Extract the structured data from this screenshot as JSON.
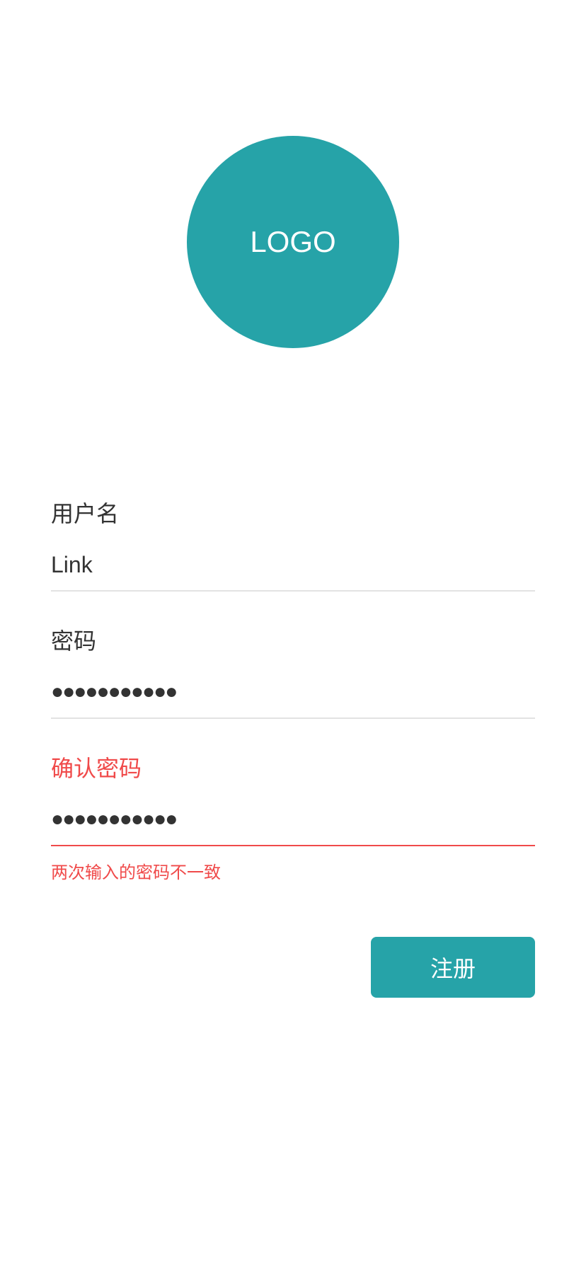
{
  "logo": {
    "text": "LOGO",
    "color": "#26a3a8"
  },
  "form": {
    "username": {
      "label": "用户名",
      "value": "Link"
    },
    "password": {
      "label": "密码",
      "value": "●●●●●●●●●●●"
    },
    "confirm_password": {
      "label": "确认密码",
      "value": "●●●●●●●●●●●",
      "error": "两次输入的密码不一致"
    }
  },
  "submit_label": "注册",
  "colors": {
    "accent": "#26a3a8",
    "error": "#f04a4a",
    "text": "#333333",
    "divider": "#e3e3e3"
  }
}
